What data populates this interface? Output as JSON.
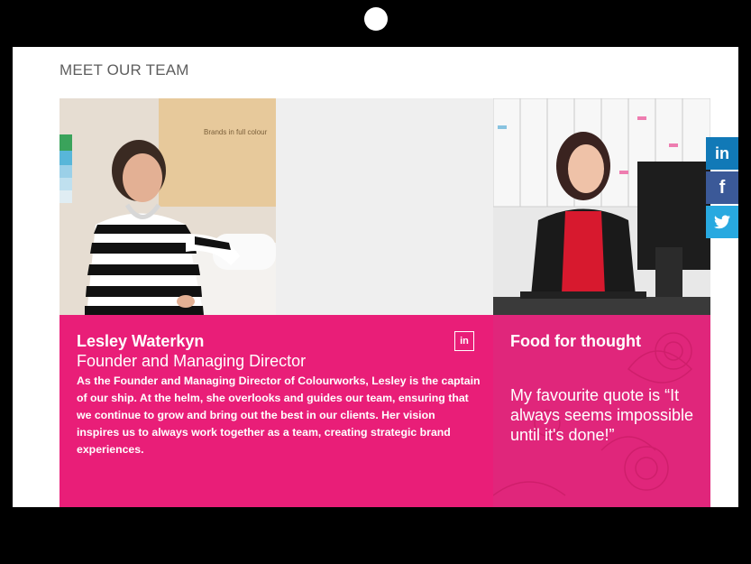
{
  "section_title": "MEET OUR TEAM",
  "member": {
    "name": "Lesley Waterkyn",
    "role": "Founder and Managing Director",
    "bio": "As the Founder and Managing Director of Colourworks, Lesley is the captain of our ship. At the helm, she overlooks and guides our team, ensuring that we continue to grow and bring out the best in our clients. Her vision inspires us to always work together as a team, creating strategic brand experiences.",
    "linkedin_label": "in"
  },
  "quote": {
    "title": "Food for thought",
    "text": "My favourite quote is “It always seems impossible until it's done!”"
  },
  "photo_left_sign": "Brands in full colour",
  "social": [
    {
      "label": "in",
      "icon": "linkedin-icon",
      "color": "#1179b7"
    },
    {
      "label": "f",
      "icon": "facebook-icon",
      "color": "#3b5998"
    },
    {
      "label": "🐦",
      "icon": "twitter-icon",
      "color": "#28a9e0"
    }
  ],
  "colors": {
    "accent_pink": "#e91e78",
    "quote_pink": "#e0267b",
    "title_gray": "#5e5e5e"
  }
}
